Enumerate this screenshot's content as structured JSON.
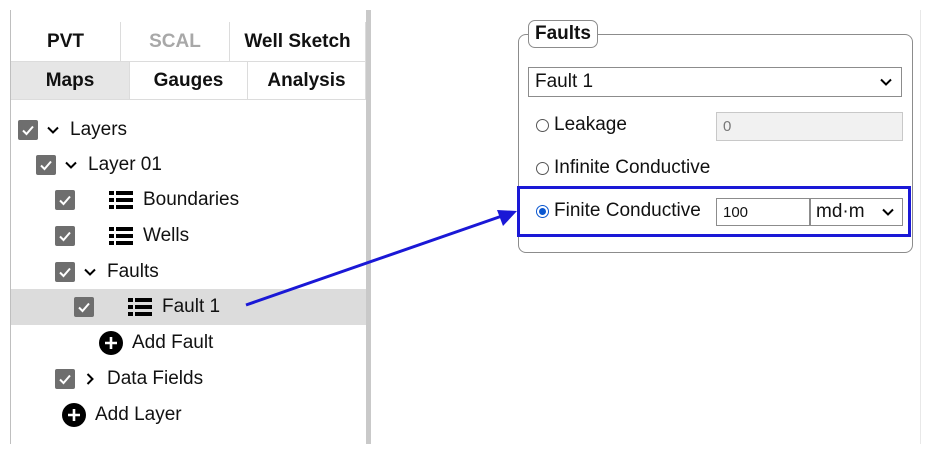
{
  "tabs": {
    "row1": [
      "PVT",
      "SCAL",
      "Well Sketch"
    ],
    "row2": [
      "Maps",
      "Gauges",
      "Analysis"
    ]
  },
  "tree": {
    "layers": "Layers",
    "layer01": "Layer 01",
    "boundaries": "Boundaries",
    "wells": "Wells",
    "faults": "Faults",
    "fault1": "Fault 1",
    "add_fault": "Add Fault",
    "data_fields": "Data Fields",
    "add_layer": "Add Layer"
  },
  "faults_panel": {
    "legend": "Faults",
    "selected_fault": "Fault 1",
    "leakage_label": "Leakage",
    "leakage_value": "0",
    "infinite_label": "Infinite Conductive",
    "finite_label": "Finite Conductive",
    "finite_value": "100",
    "finite_unit": "md·m"
  },
  "colors": {
    "highlight": "#1a18d6",
    "arrow": "#1a18d6",
    "radio_selected": "#0b57d0",
    "checkbox": "#6e6e6e",
    "selected_row": "#dcdcdc"
  }
}
